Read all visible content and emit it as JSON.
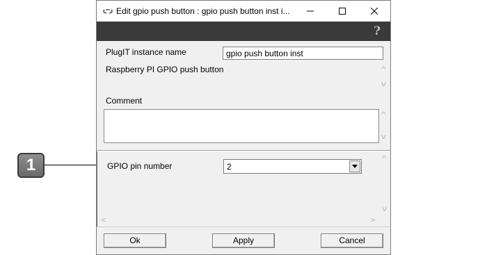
{
  "window": {
    "title": "Edit gpio push button : gpio push button inst i...",
    "icon": "chain-link-icon",
    "controls": [
      "minimize-icon",
      "maximize-icon",
      "close-icon"
    ]
  },
  "toolbar": {
    "help_icon": "help-question-icon",
    "help_glyph": "?"
  },
  "form": {
    "instance_label": "PlugIT instance name",
    "instance_value": "gpio push button inst",
    "description": "Raspberry PI GPIO push button",
    "comment_label": "Comment",
    "comment_value": "",
    "gpio_label": "GPIO pin number",
    "gpio_value": "2"
  },
  "buttons": {
    "ok": "Ok",
    "apply": "Apply",
    "cancel": "Cancel"
  },
  "callout": {
    "number": "1"
  },
  "colors": {
    "toolbar": "#3a3a3a",
    "dialog_bg": "#f0f0f0",
    "callout_badge": "#7a7a7a"
  }
}
